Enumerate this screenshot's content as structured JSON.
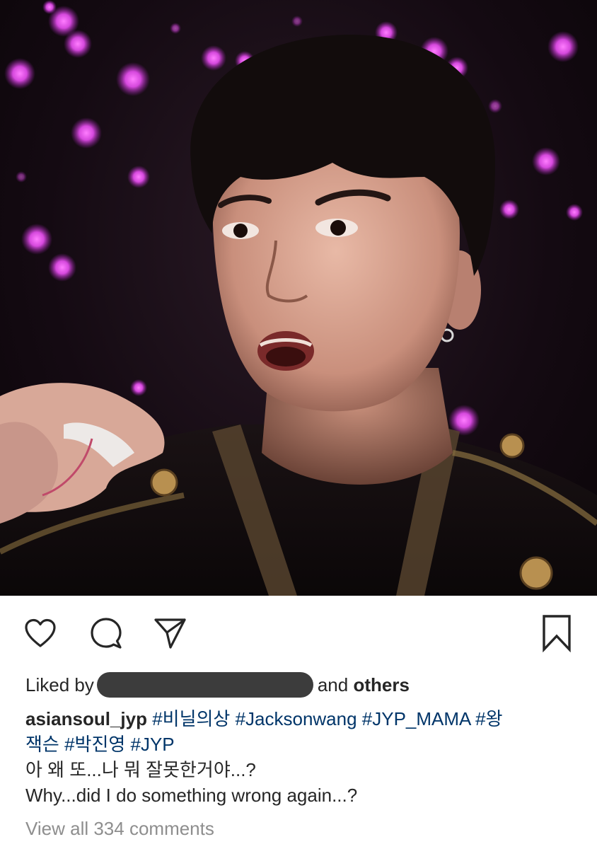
{
  "post": {
    "image_alt": "Photo of a performer with a surprised expression in front of purple concert light sticks",
    "liked_by_prefix": "Liked by",
    "liked_by_suffix_and": "and",
    "liked_by_suffix_others": "others",
    "username": "asiansoul_jyp",
    "hashtags": [
      "#비닐의상",
      "#Jacksonwang",
      "#JYP_MAMA",
      "#왕잭슨",
      "#박진영",
      "#JYP"
    ],
    "hashtag_line1": "#비닐의상 #Jacksonwang #JYP_MAMA #왕",
    "hashtag_line2": "잭슨 #박진영 #JYP",
    "caption_korean": "아 왜 또...나 뭐 잘못한거야...?",
    "caption_english": "Why...did I do something wrong again...?",
    "view_comments": "View all 334 comments"
  },
  "icons": {
    "like": "heart-icon",
    "comment": "comment-bubble-icon",
    "share": "paper-plane-icon",
    "save": "bookmark-icon"
  },
  "colors": {
    "text": "#262626",
    "hashtag": "#003569",
    "muted": "#8e8e8e",
    "lightstick": "#e04ce8"
  }
}
